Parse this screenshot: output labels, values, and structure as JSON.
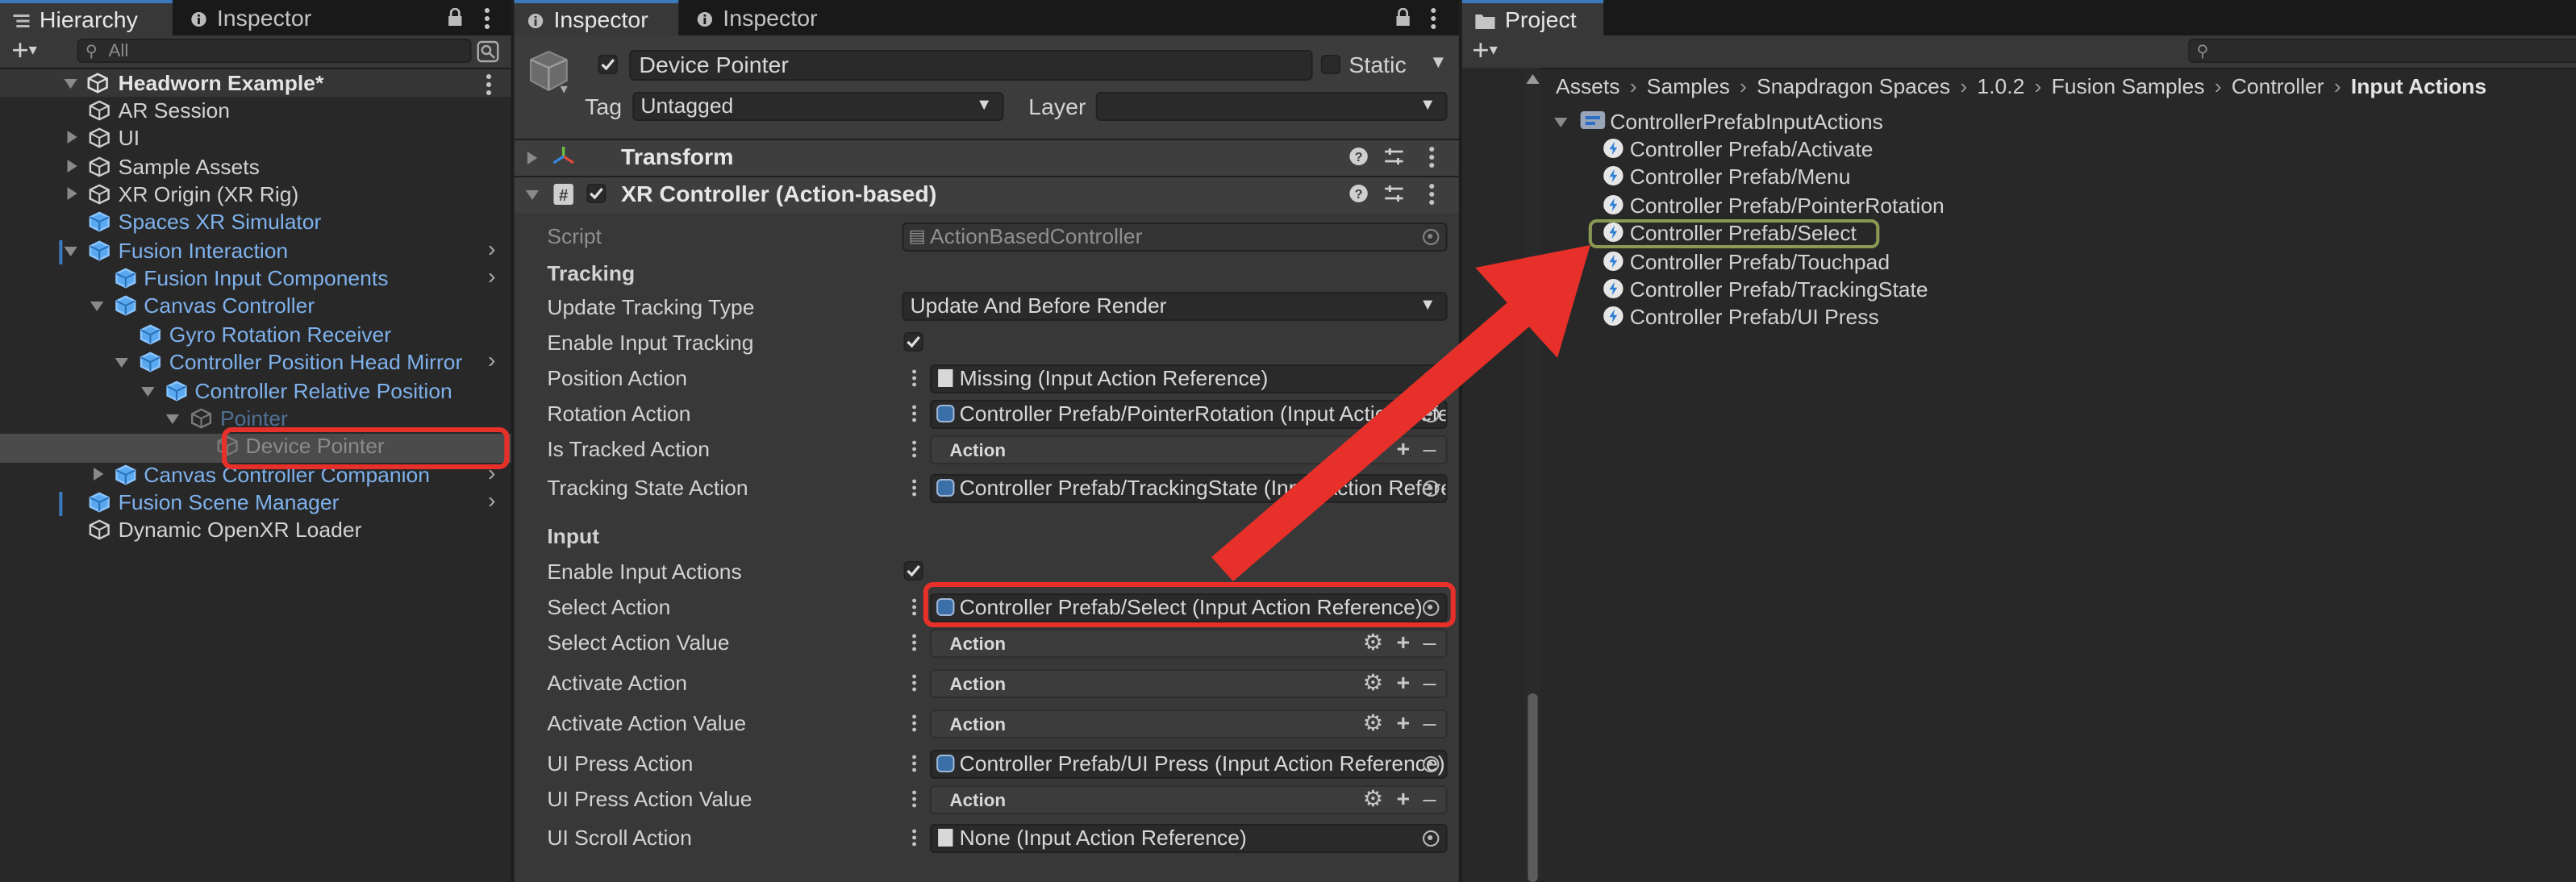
{
  "hierarchy": {
    "tabs": [
      {
        "label": "Hierarchy",
        "icon": "list-icon"
      },
      {
        "label": "Inspector",
        "icon": "info-icon"
      }
    ],
    "search_placeholder": "All",
    "scene_name": "Headworn Example*",
    "items": [
      {
        "label": "AR Session",
        "style": "normal",
        "depth": 2,
        "expand": "none"
      },
      {
        "label": "UI",
        "style": "normal",
        "depth": 2,
        "expand": "collapsed"
      },
      {
        "label": "Sample Assets",
        "style": "normal",
        "depth": 2,
        "expand": "collapsed"
      },
      {
        "label": "XR Origin (XR Rig)",
        "style": "normal",
        "depth": 2,
        "expand": "collapsed"
      },
      {
        "label": "Spaces XR Simulator",
        "style": "prefab",
        "depth": 2,
        "expand": "none"
      },
      {
        "label": "Fusion Interaction",
        "style": "prefab",
        "depth": 2,
        "expand": "expanded"
      },
      {
        "label": "Fusion Input Components",
        "style": "prefab",
        "depth": 3,
        "expand": "none"
      },
      {
        "label": "Canvas Controller",
        "style": "prefab",
        "depth": 3,
        "expand": "expanded"
      },
      {
        "label": "Gyro Rotation Receiver",
        "style": "prefab",
        "depth": 4,
        "expand": "none"
      },
      {
        "label": "Controller Position Head Mirror",
        "style": "prefab",
        "depth": 4,
        "expand": "expanded"
      },
      {
        "label": "Controller Relative Position",
        "style": "prefab",
        "depth": 5,
        "expand": "expanded"
      },
      {
        "label": "Pointer",
        "style": "disabled",
        "depth": 6,
        "expand": "expanded"
      },
      {
        "label": "Device Pointer",
        "style": "selected",
        "depth": 7,
        "expand": "none"
      },
      {
        "label": "Canvas Controller Companion",
        "style": "prefab",
        "depth": 3,
        "expand": "collapsed"
      },
      {
        "label": "Fusion Scene Manager",
        "style": "prefab",
        "depth": 2,
        "expand": "none"
      },
      {
        "label": "Dynamic OpenXR Loader",
        "style": "normal",
        "depth": 2,
        "expand": "none"
      }
    ]
  },
  "inspector": {
    "tabs": [
      {
        "label": "Inspector",
        "icon": "info-icon"
      },
      {
        "label": "Inspector",
        "icon": "info-icon"
      }
    ],
    "object_name": "Device Pointer",
    "static_label": "Static",
    "tag_label": "Tag",
    "tag_value": "Untagged",
    "layer_label": "Layer",
    "layer_value": "",
    "components": [
      {
        "label": "Transform"
      },
      {
        "label": "XR Controller (Action-based)"
      }
    ],
    "script_label": "Script",
    "script_value": "ActionBasedController",
    "tracking_header": "Tracking",
    "input_header": "Input",
    "action_label": "Action",
    "fields": {
      "update_tracking_type": {
        "label": "Update Tracking Type",
        "value": "Update And Before Render"
      },
      "enable_input_tracking": {
        "label": "Enable Input Tracking",
        "checked": true
      },
      "position_action": {
        "label": "Position Action",
        "value": "Missing (Input Action Reference)"
      },
      "rotation_action": {
        "label": "Rotation Action",
        "value": "Controller Prefab/PointerRotation (Input Action Reference)"
      },
      "is_tracked_action": {
        "label": "Is Tracked Action"
      },
      "tracking_state_action": {
        "label": "Tracking State Action",
        "value": "Controller Prefab/TrackingState (Input Action Reference)"
      },
      "enable_input_actions": {
        "label": "Enable Input Actions",
        "checked": true
      },
      "select_action": {
        "label": "Select Action",
        "value": "Controller Prefab/Select (Input Action Reference)"
      },
      "select_action_value": {
        "label": "Select Action Value"
      },
      "activate_action": {
        "label": "Activate Action"
      },
      "activate_action_value": {
        "label": "Activate Action Value"
      },
      "ui_press_action": {
        "label": "UI Press Action",
        "value": "Controller Prefab/UI Press (Input Action Reference)"
      },
      "ui_press_action_value": {
        "label": "UI Press Action Value"
      },
      "ui_scroll_action": {
        "label": "UI Scroll Action",
        "value": "None (Input Action Reference)"
      }
    }
  },
  "project": {
    "tab_label": "Project",
    "breadcrumb": [
      "Assets",
      "Samples",
      "Snapdragon Spaces",
      "1.0.2",
      "Fusion Samples",
      "Controller",
      "Input Actions"
    ],
    "asset_root": "ControllerPrefabInputActions",
    "actions": [
      "Controller Prefab/Activate",
      "Controller Prefab/Menu",
      "Controller Prefab/PointerRotation",
      "Controller Prefab/Select",
      "Controller Prefab/Touchpad",
      "Controller Prefab/TrackingState",
      "Controller Prefab/UI Press"
    ],
    "highlighted_action": "Controller Prefab/Select"
  },
  "colors": {
    "highlight_red": "#e8302a",
    "prefab_blue": "#7eb1ec",
    "selected_tab_accent": "#3a79bb"
  }
}
